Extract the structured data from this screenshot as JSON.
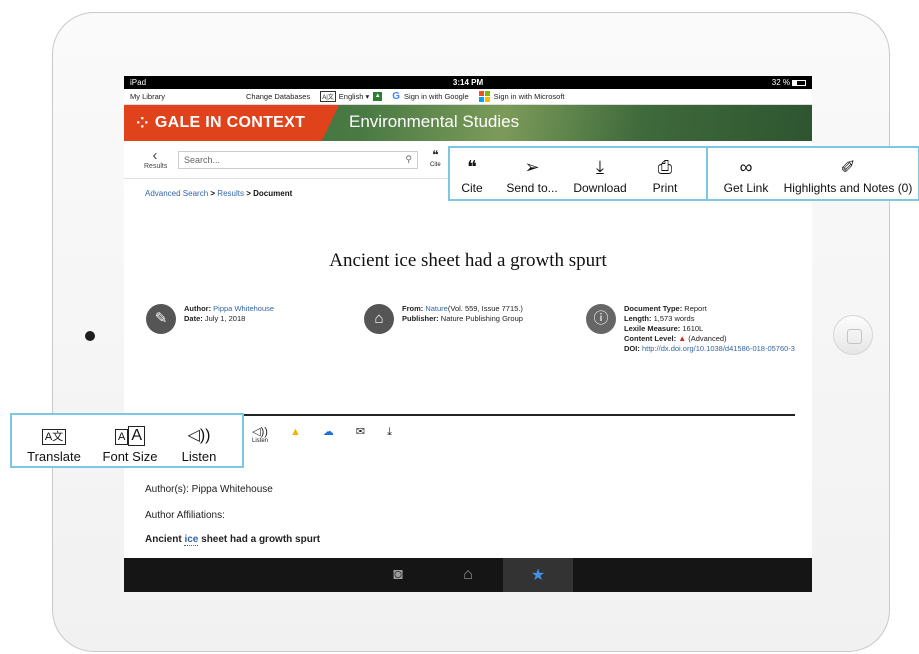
{
  "statusbar": {
    "device": "iPad",
    "time": "3:14 PM",
    "battery": "32 %"
  },
  "toplinks": {
    "my_library": "My Library",
    "change_databases": "Change Databases",
    "language_tag": "A|文",
    "language": "English",
    "google": "Sign in with Google",
    "microsoft": "Sign in with Microsoft"
  },
  "banner": {
    "brand": "GALE IN CONTEXT",
    "subject": "Environmental Studies"
  },
  "toolbar": {
    "back_label": "Results",
    "search_placeholder": "Search...",
    "cite_small": "Cite"
  },
  "breadcrumb": {
    "advanced": "Advanced Search",
    "results": "Results",
    "current": "Document",
    "sep": ">"
  },
  "article": {
    "title": "Ancient ice sheet had a growth spurt",
    "author_label": "Author:",
    "author": "Pippa Whitehouse",
    "date_label": "Date:",
    "date": "July 1, 2018",
    "from_label": "From:",
    "from_source": "Nature",
    "from_detail": "(Vol. 559, Issue 7715.)",
    "publisher_label": "Publisher:",
    "publisher": "Nature Publishing Group",
    "doctype_label": "Document Type:",
    "doctype": "Report",
    "length_label": "Length:",
    "length": "1,573 words",
    "lexile_label": "Lexile Measure:",
    "lexile": "1610L",
    "content_label": "Content Level:",
    "content": "(Advanced)",
    "doi_label": "DOI:",
    "doi": "http://dx.doi.org/10.1038/d41586-018-05760-3"
  },
  "minitools": {
    "listen_small": "Listen"
  },
  "body": {
    "authors": "Author(s): Pippa Whitehouse",
    "affiliations": "Author Affiliations:",
    "heading_pre": "Ancient",
    "heading_hl": "ice",
    "heading_post": "sheet had a growth spurt"
  },
  "callout_doc_tools": [
    {
      "label": "Cite",
      "icon": "quote-icon"
    },
    {
      "label": "Send to...",
      "icon": "send-icon"
    },
    {
      "label": "Download",
      "icon": "download-icon"
    },
    {
      "label": "Print",
      "icon": "print-icon"
    },
    {
      "label": "Get Link",
      "icon": "link-icon"
    },
    {
      "label": "Highlights and Notes (0)",
      "icon": "highlighter-icon"
    }
  ],
  "callout_read_tools": [
    {
      "label": "Translate",
      "icon": "translate-icon"
    },
    {
      "label": "Font Size",
      "icon": "font-size-icon"
    },
    {
      "label": "Listen",
      "icon": "speaker-icon"
    }
  ],
  "colors": {
    "accent": "#e0421c",
    "callout": "#7fc6e3",
    "link": "#3465a4"
  }
}
